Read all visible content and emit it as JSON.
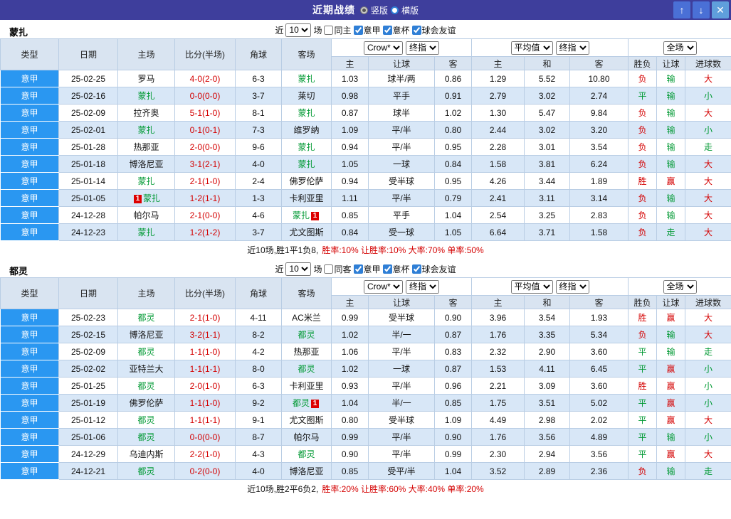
{
  "topbar": {
    "title": "近期战绩",
    "layout_options": [
      {
        "label": "竖版",
        "selected": true
      },
      {
        "label": "横版",
        "selected": false
      }
    ],
    "icons": {
      "up": "↑",
      "down": "↓",
      "close": "✕"
    }
  },
  "columns": {
    "main": [
      "类型",
      "日期",
      "主场",
      "比分(半场)",
      "角球",
      "客场"
    ],
    "sub": [
      "主",
      "让球",
      "客",
      "主",
      "和",
      "客",
      "胜负",
      "让球",
      "进球数"
    ]
  },
  "colors": {
    "topbar_bg": "#3e3e9c",
    "league_bg": "#2a97f1",
    "score_red": "#d40000",
    "team_green": "#009933",
    "result": {
      "胜": "#d40000",
      "负": "#d40000",
      "平": "#009933",
      "赢": "#d40000",
      "输": "#009933",
      "走": "#009933",
      "大": "#d40000",
      "小": "#009933"
    }
  },
  "sections": [
    {
      "team": "蒙扎",
      "filter": {
        "prefix": "近",
        "count": "10",
        "suffix": "场",
        "checkboxes": [
          {
            "label": "同主",
            "checked": false
          },
          {
            "label": "意甲",
            "checked": true
          },
          {
            "label": "意杯",
            "checked": true
          },
          {
            "label": "球会友谊",
            "checked": true
          }
        ]
      },
      "dropdowns": {
        "company": "Crow*",
        "company_stage": "终指",
        "average": "平均值",
        "average_stage": "终指",
        "scope": "全场"
      },
      "rows": [
        {
          "league": "意甲",
          "date": "25-02-25",
          "home": "罗马",
          "score": "4-0(2-0)",
          "corner": "6-3",
          "away": "蒙扎",
          "away_focus": true,
          "asia": [
            "1.03",
            "球半/两",
            "0.86"
          ],
          "euro": [
            "1.29",
            "5.52",
            "10.80"
          ],
          "res": [
            "负",
            "输",
            "大"
          ]
        },
        {
          "league": "意甲",
          "date": "25-02-16",
          "home": "蒙扎",
          "home_focus": true,
          "score": "0-0(0-0)",
          "corner": "3-7",
          "away": "莱切",
          "asia": [
            "0.98",
            "平手",
            "0.91"
          ],
          "euro": [
            "2.79",
            "3.02",
            "2.74"
          ],
          "res": [
            "平",
            "输",
            "小"
          ]
        },
        {
          "league": "意甲",
          "date": "25-02-09",
          "home": "拉齐奥",
          "score": "5-1(1-0)",
          "corner": "8-1",
          "away": "蒙扎",
          "away_focus": true,
          "asia": [
            "0.87",
            "球半",
            "1.02"
          ],
          "euro": [
            "1.30",
            "5.47",
            "9.84"
          ],
          "res": [
            "负",
            "输",
            "大"
          ]
        },
        {
          "league": "意甲",
          "date": "25-02-01",
          "home": "蒙扎",
          "home_focus": true,
          "score": "0-1(0-1)",
          "corner": "7-3",
          "away": "维罗纳",
          "asia": [
            "1.09",
            "平/半",
            "0.80"
          ],
          "euro": [
            "2.44",
            "3.02",
            "3.20"
          ],
          "res": [
            "负",
            "输",
            "小"
          ]
        },
        {
          "league": "意甲",
          "date": "25-01-28",
          "home": "热那亚",
          "score": "2-0(0-0)",
          "corner": "9-6",
          "away": "蒙扎",
          "away_focus": true,
          "asia": [
            "0.94",
            "平/半",
            "0.95"
          ],
          "euro": [
            "2.28",
            "3.01",
            "3.54"
          ],
          "res": [
            "负",
            "输",
            "走"
          ]
        },
        {
          "league": "意甲",
          "date": "25-01-18",
          "home": "博洛尼亚",
          "score": "3-1(2-1)",
          "corner": "4-0",
          "away": "蒙扎",
          "away_focus": true,
          "asia": [
            "1.05",
            "一球",
            "0.84"
          ],
          "euro": [
            "1.58",
            "3.81",
            "6.24"
          ],
          "res": [
            "负",
            "输",
            "大"
          ]
        },
        {
          "league": "意甲",
          "date": "25-01-14",
          "home": "蒙扎",
          "home_focus": true,
          "score": "2-1(1-0)",
          "corner": "2-4",
          "away": "佛罗伦萨",
          "asia": [
            "0.94",
            "受半球",
            "0.95"
          ],
          "euro": [
            "4.26",
            "3.44",
            "1.89"
          ],
          "res": [
            "胜",
            "赢",
            "大"
          ]
        },
        {
          "league": "意甲",
          "date": "25-01-05",
          "home": "蒙扎",
          "home_focus": true,
          "home_card": "1",
          "home_card_side": "left",
          "score": "1-2(1-1)",
          "corner": "1-3",
          "away": "卡利亚里",
          "asia": [
            "1.11",
            "平/半",
            "0.79"
          ],
          "euro": [
            "2.41",
            "3.11",
            "3.14"
          ],
          "res": [
            "负",
            "输",
            "大"
          ]
        },
        {
          "league": "意甲",
          "date": "24-12-28",
          "home": "帕尔马",
          "score": "2-1(0-0)",
          "corner": "4-6",
          "away": "蒙扎",
          "away_focus": true,
          "away_card": "1",
          "away_card_side": "right",
          "asia": [
            "0.85",
            "平手",
            "1.04"
          ],
          "euro": [
            "2.54",
            "3.25",
            "2.83"
          ],
          "res": [
            "负",
            "输",
            "大"
          ]
        },
        {
          "league": "意甲",
          "date": "24-12-23",
          "home": "蒙扎",
          "home_focus": true,
          "score": "1-2(1-2)",
          "corner": "3-7",
          "away": "尤文图斯",
          "asia": [
            "0.84",
            "受一球",
            "1.05"
          ],
          "euro": [
            "6.64",
            "3.71",
            "1.58"
          ],
          "res": [
            "负",
            "走",
            "大"
          ]
        }
      ],
      "summary": {
        "prefix": "近10场,胜1平1负8,",
        "stats": "胜率:10% 让胜率:10% 大率:70% 单率:50%"
      }
    },
    {
      "team": "都灵",
      "filter": {
        "prefix": "近",
        "count": "10",
        "suffix": "场",
        "checkboxes": [
          {
            "label": "同客",
            "checked": false
          },
          {
            "label": "意甲",
            "checked": true
          },
          {
            "label": "意杯",
            "checked": true
          },
          {
            "label": "球会友谊",
            "checked": true
          }
        ]
      },
      "dropdowns": {
        "company": "Crow*",
        "company_stage": "终指",
        "average": "平均值",
        "average_stage": "终指",
        "scope": "全场"
      },
      "rows": [
        {
          "league": "意甲",
          "date": "25-02-23",
          "home": "都灵",
          "home_focus": true,
          "score": "2-1(1-0)",
          "corner": "4-11",
          "away": "AC米兰",
          "asia": [
            "0.99",
            "受半球",
            "0.90"
          ],
          "euro": [
            "3.96",
            "3.54",
            "1.93"
          ],
          "res": [
            "胜",
            "赢",
            "大"
          ]
        },
        {
          "league": "意甲",
          "date": "25-02-15",
          "home": "博洛尼亚",
          "score": "3-2(1-1)",
          "corner": "8-2",
          "away": "都灵",
          "away_focus": true,
          "asia": [
            "1.02",
            "半/一",
            "0.87"
          ],
          "euro": [
            "1.76",
            "3.35",
            "5.34"
          ],
          "res": [
            "负",
            "输",
            "大"
          ]
        },
        {
          "league": "意甲",
          "date": "25-02-09",
          "home": "都灵",
          "home_focus": true,
          "score": "1-1(1-0)",
          "corner": "4-2",
          "away": "热那亚",
          "asia": [
            "1.06",
            "平/半",
            "0.83"
          ],
          "euro": [
            "2.32",
            "2.90",
            "3.60"
          ],
          "res": [
            "平",
            "输",
            "走"
          ]
        },
        {
          "league": "意甲",
          "date": "25-02-02",
          "home": "亚特兰大",
          "score": "1-1(1-1)",
          "corner": "8-0",
          "away": "都灵",
          "away_focus": true,
          "asia": [
            "1.02",
            "一球",
            "0.87"
          ],
          "euro": [
            "1.53",
            "4.11",
            "6.45"
          ],
          "res": [
            "平",
            "赢",
            "小"
          ]
        },
        {
          "league": "意甲",
          "date": "25-01-25",
          "home": "都灵",
          "home_focus": true,
          "score": "2-0(1-0)",
          "corner": "6-3",
          "away": "卡利亚里",
          "asia": [
            "0.93",
            "平/半",
            "0.96"
          ],
          "euro": [
            "2.21",
            "3.09",
            "3.60"
          ],
          "res": [
            "胜",
            "赢",
            "小"
          ]
        },
        {
          "league": "意甲",
          "date": "25-01-19",
          "home": "佛罗伦萨",
          "score": "1-1(1-0)",
          "corner": "9-2",
          "away": "都灵",
          "away_focus": true,
          "away_card": "1",
          "away_card_side": "right",
          "asia": [
            "1.04",
            "半/一",
            "0.85"
          ],
          "euro": [
            "1.75",
            "3.51",
            "5.02"
          ],
          "res": [
            "平",
            "赢",
            "小"
          ]
        },
        {
          "league": "意甲",
          "date": "25-01-12",
          "home": "都灵",
          "home_focus": true,
          "score": "1-1(1-1)",
          "corner": "9-1",
          "away": "尤文图斯",
          "asia": [
            "0.80",
            "受半球",
            "1.09"
          ],
          "euro": [
            "4.49",
            "2.98",
            "2.02"
          ],
          "res": [
            "平",
            "赢",
            "大"
          ]
        },
        {
          "league": "意甲",
          "date": "25-01-06",
          "home": "都灵",
          "home_focus": true,
          "score": "0-0(0-0)",
          "corner": "8-7",
          "away": "帕尔马",
          "asia": [
            "0.99",
            "平/半",
            "0.90"
          ],
          "euro": [
            "1.76",
            "3.56",
            "4.89"
          ],
          "res": [
            "平",
            "输",
            "小"
          ]
        },
        {
          "league": "意甲",
          "date": "24-12-29",
          "home": "乌迪内斯",
          "score": "2-2(1-0)",
          "corner": "4-3",
          "away": "都灵",
          "away_focus": true,
          "asia": [
            "0.90",
            "平/半",
            "0.99"
          ],
          "euro": [
            "2.30",
            "2.94",
            "3.56"
          ],
          "res": [
            "平",
            "赢",
            "大"
          ]
        },
        {
          "league": "意甲",
          "date": "24-12-21",
          "home": "都灵",
          "home_focus": true,
          "score": "0-2(0-0)",
          "corner": "4-0",
          "away": "博洛尼亚",
          "asia": [
            "0.85",
            "受平/半",
            "1.04"
          ],
          "euro": [
            "3.52",
            "2.89",
            "2.36"
          ],
          "res": [
            "负",
            "输",
            "走"
          ]
        }
      ],
      "summary": {
        "prefix": "近10场,胜2平6负2,",
        "stats": "胜率:20% 让胜率:60% 大率:40% 单率:20%"
      }
    }
  ]
}
